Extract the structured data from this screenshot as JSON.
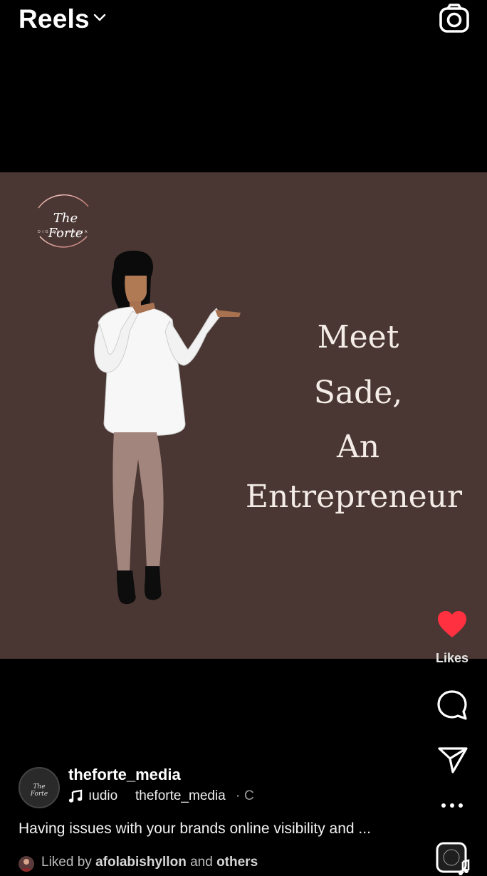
{
  "header": {
    "title": "Reels"
  },
  "reel": {
    "logo_script": "The Forte",
    "logo_sub": "DIGITAL MEDIA",
    "headline": [
      "Meet",
      "Sade,",
      "An",
      "Entrepreneur"
    ],
    "background_color": "#4a3733"
  },
  "actions": {
    "likes_label": "Likes",
    "like_color": "#ff3040"
  },
  "post": {
    "username": "theforte_media",
    "audio_text": "ıudio",
    "audio_owner": "theforte_media",
    "audio_separator": "·",
    "audio_trail": "C",
    "caption": "Having issues with your brands online visibility and ...",
    "liked_prefix": "Liked by",
    "liked_user": "afolabishyllon",
    "liked_and": "and",
    "liked_others": "others",
    "avatar_text": "The Forte"
  }
}
